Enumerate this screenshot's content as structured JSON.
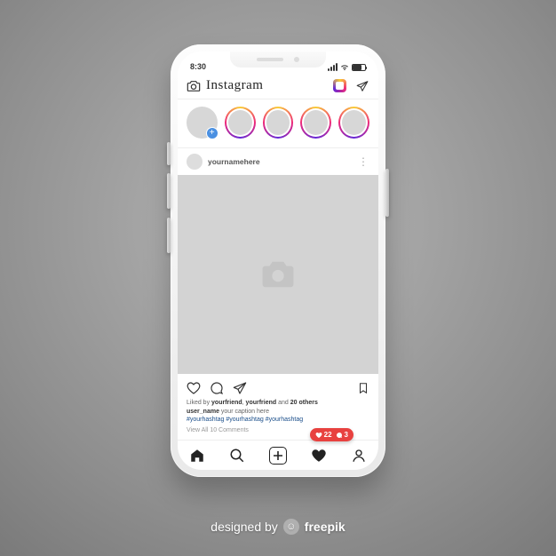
{
  "statusbar": {
    "time": "8:30"
  },
  "header": {
    "app_name": "Instagram"
  },
  "stories": {
    "count": 4
  },
  "post": {
    "username": "yournamehere",
    "likes_line_prefix": "Liked by ",
    "liker1": "yourfriend",
    "sep": ", ",
    "liker2": "yourfriend",
    "and": " and ",
    "others": "20 others",
    "caption_user": "user_name",
    "caption_text": " your caption here",
    "hashtags": "#yourhashtag #yourhashtag #yourhashtag",
    "view_comments": "View All 10 Comments"
  },
  "notifications": {
    "likes": "22",
    "comments": "3"
  },
  "credit": {
    "designed_by": "designed by",
    "brand": "freepik"
  }
}
